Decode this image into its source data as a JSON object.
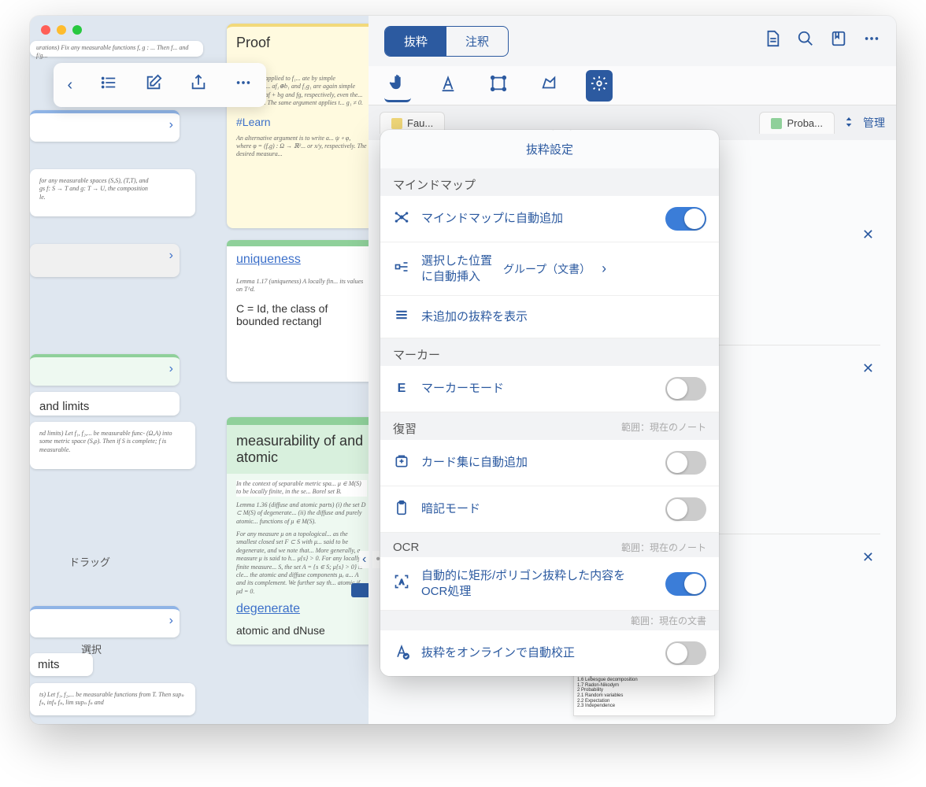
{
  "segmented": {
    "left": "抜粋",
    "right": "注釈"
  },
  "toolbar_float": {
    "back": "‹",
    "list": "☰",
    "compose": "✎",
    "share": "⇧",
    "more": "⋯"
  },
  "top_icons": {
    "doc": "📄",
    "search": "🔍",
    "bookmark": "🔖",
    "more": "⋯"
  },
  "tabs": {
    "proba": "Proba...",
    "fau": "Fau...",
    "manage": "管理"
  },
  "popover": {
    "title": "抜粋設定",
    "sec_mindmap": "マインドマップ",
    "row_auto_add": "マインドマップに自動追加",
    "row_insert_label": "選択した位置に自動挿入",
    "row_insert_value": "グループ（文書）",
    "row_unshown": "未追加の抜粋を表示",
    "sec_marker": "マーカー",
    "row_marker": "マーカーモード",
    "sec_review": "復習",
    "scope_note": "範囲：現在のノート",
    "row_cardset": "カード集に自動追加",
    "row_memo": "暗記モード",
    "sec_ocr": "OCR",
    "row_ocr_auto": "自動的に矩形/ポリゴン抜粋した内容を OCR処理",
    "scope_doc": "範囲：現在の文書",
    "row_correct": "抜粋をオンラインで自動校正"
  },
  "cards": {
    "proof": "Proof",
    "proof_body": "emma 1.11 applied to f₁... ate by simple measurable... af₁⊕b₁ and f₁g₁ are again simple measu... of af + bg and fg, respectively, even the... Lemma 1.9. The same argument applies t... g₁ ≠ 0.",
    "learn": "#Learn",
    "learn_body": "An alternative argument is to write a... ψ ∘ φ, where φ = (f,g) : Ω → ℝ²... or x/y, respectively. The desired measura...",
    "uniqueness": "uniqueness",
    "uniq_lemma": "Lemma 1.17 (uniqueness) A locally fin... its values on T^d.",
    "uniq_c": "C = Id, the class of bounded rectangl",
    "limits": "and limits",
    "limits_body": "nd limits) Let f₁, f₂,... be measurable func-\n(Ω,A) into some metric space (S,ρ). Then\nif S is complete;\nf is measurable.",
    "meas": "measurability of and atomic",
    "meas_body": "In the context of separable metric spa... μ ∈ M(S) to be locally finite, in the se... Borel set B.",
    "meas_lemma": "Lemma 1.36 (diffuse and atomic parts)\n(i) the set D ⊂ M(S) of degenerate...\n(ii) the diffuse and purely atomic...\nfunctions of μ ∈ M(S).",
    "meas_para": "For any measure μ on a topological... as the smallest closed set F ⊂ S with μ... said to be degenerate, and we note that... More generally, a measure μ is said to h... μ{s} > 0. For any locally finite measure... S, the set A = {s ∈ S; μ{s} > 0} is cle... the atomic and diffuse components μₐ a... A and its complement. We further say th... atomic if μd = 0.",
    "degen": "degenerate",
    "degen_body": "atomic and dNuse",
    "mits": "mits",
    "mits_body": "ts) Let f₁, f₂,... be measurable functions from T. Then supₙ fₙ, infₙ fₙ, lim supₙ fₙ and",
    "drag": "ドラッグ",
    "select": "選択",
    "measfunc": "urations) Fix any measurable functions f, g : ... Then f... and f/g..."
  }
}
